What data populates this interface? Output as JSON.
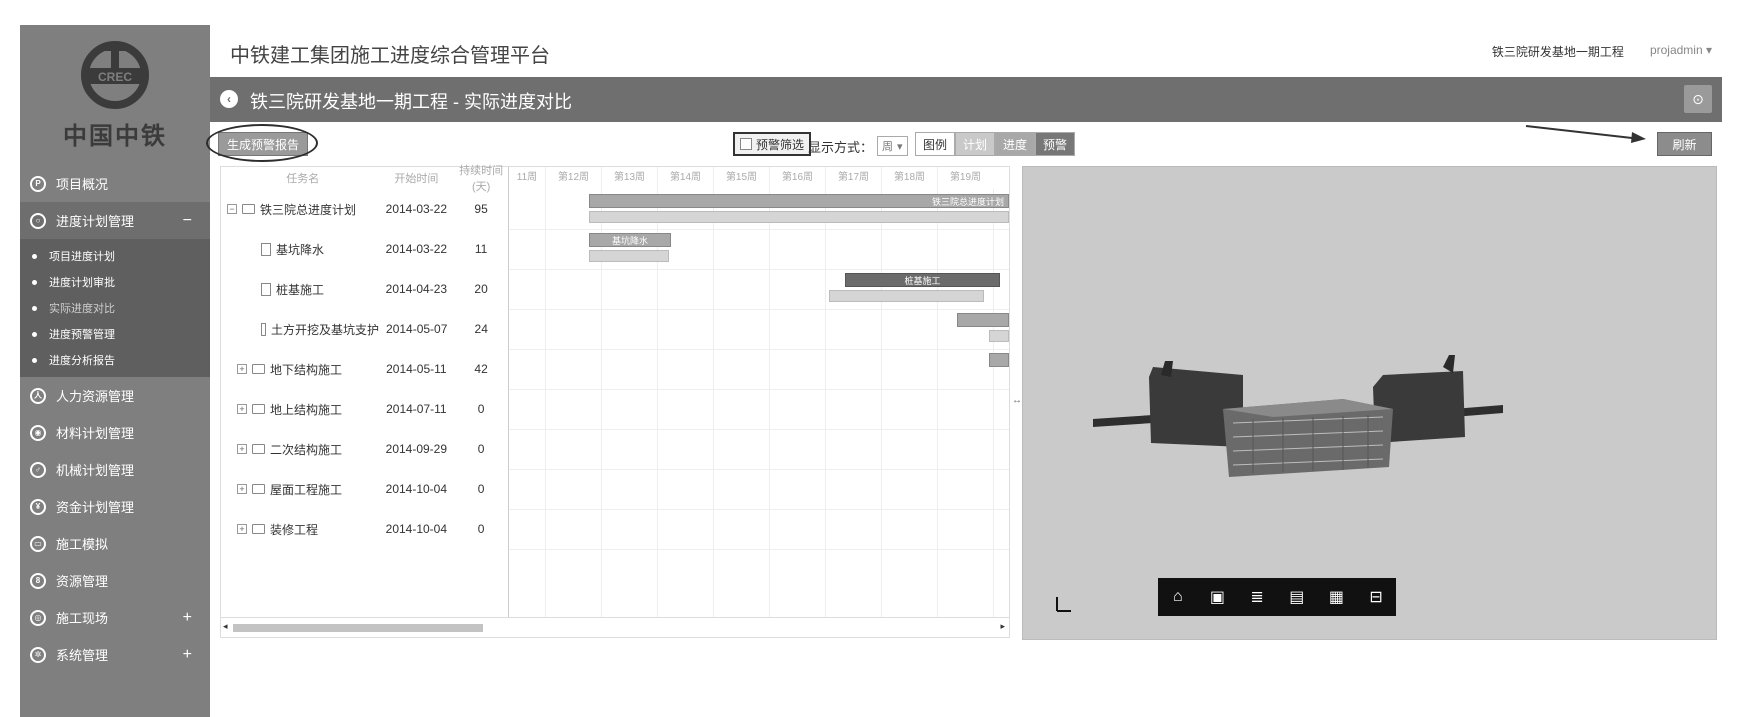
{
  "sidebar": {
    "logo_text": "中国中铁",
    "logo_mark": "CREC",
    "nav": [
      {
        "label": "项目概况",
        "icon": "info-icon",
        "glyph": "P"
      },
      {
        "label": "进度计划管理",
        "icon": "schedule-icon",
        "glyph": "○",
        "toggle": "−"
      },
      {
        "label": "人力资源管理",
        "icon": "person-icon",
        "glyph": "人"
      },
      {
        "label": "材料计划管理",
        "icon": "material-icon",
        "glyph": "◉"
      },
      {
        "label": "机械计划管理",
        "icon": "machine-icon",
        "glyph": "♂"
      },
      {
        "label": "资金计划管理",
        "icon": "yuan-icon",
        "glyph": "¥"
      },
      {
        "label": "施工模拟",
        "icon": "simulation-icon",
        "glyph": "▭"
      },
      {
        "label": "资源管理",
        "icon": "resource-icon",
        "glyph": "8"
      },
      {
        "label": "施工现场",
        "icon": "site-icon",
        "glyph": "◎",
        "toggle": "+"
      },
      {
        "label": "系统管理",
        "icon": "system-icon",
        "glyph": "✲",
        "toggle": "+"
      }
    ],
    "subnav": [
      {
        "label": "项目进度计划"
      },
      {
        "label": "进度计划审批"
      },
      {
        "label": "实际进度对比"
      },
      {
        "label": "进度预警管理"
      },
      {
        "label": "进度分析报告"
      }
    ]
  },
  "header": {
    "app_title": "中铁建工集团施工进度综合管理平台",
    "project_name": "铁三院研发基地一期工程",
    "user": "projadmin ▾"
  },
  "titlebar": {
    "page_title": "铁三院研发基地一期工程 - 实际进度对比"
  },
  "toolbar": {
    "gen_report_label": "生成预警报告",
    "warn_filter_label": "预警筛选",
    "display_mode_label": "显示方式：",
    "display_mode_value": "周",
    "tab_legend": "图例",
    "tab_plan": "计划",
    "tab_progress": "进度",
    "tab_warn": "预警",
    "refresh_label": "刷新"
  },
  "gantt": {
    "headers": {
      "name": "任务名",
      "start": "开始时间",
      "duration": "持续时间(天)"
    },
    "weeks": [
      "11周",
      "第12周",
      "第13周",
      "第14周",
      "第15周",
      "第16周",
      "第17周",
      "第18周",
      "第19周"
    ],
    "rows": [
      {
        "name": "铁三院总进度计划",
        "start": "2014-03-22",
        "duration": "95",
        "type": "root"
      },
      {
        "name": "基坑降水",
        "start": "2014-03-22",
        "duration": "11",
        "type": "task"
      },
      {
        "name": "桩基施工",
        "start": "2014-04-23",
        "duration": "20",
        "type": "task"
      },
      {
        "name": "土方开挖及基坑支护",
        "start": "2014-05-07",
        "duration": "24",
        "type": "task"
      },
      {
        "name": "地下结构施工",
        "start": "2014-05-11",
        "duration": "42",
        "type": "group"
      },
      {
        "name": "地上结构施工",
        "start": "2014-07-11",
        "duration": "0",
        "type": "group"
      },
      {
        "name": "二次结构施工",
        "start": "2014-09-29",
        "duration": "0",
        "type": "group"
      },
      {
        "name": "屋面工程施工",
        "start": "2014-10-04",
        "duration": "0",
        "type": "group"
      },
      {
        "name": "装修工程",
        "start": "2014-10-04",
        "duration": "0",
        "type": "group"
      }
    ],
    "bar_labels": {
      "root": "铁三院总进度计划",
      "dewater": "基坑降水",
      "pile": "桩基施工"
    }
  },
  "viewer": {
    "tools": [
      {
        "icon": "home-icon",
        "glyph": "⌂"
      },
      {
        "icon": "camera-icon",
        "glyph": "▣"
      },
      {
        "icon": "layers-icon",
        "glyph": "≣"
      },
      {
        "icon": "document-icon",
        "glyph": "▤"
      },
      {
        "icon": "grid-icon",
        "glyph": "▦"
      },
      {
        "icon": "toolbox-icon",
        "glyph": "⊟"
      }
    ]
  }
}
